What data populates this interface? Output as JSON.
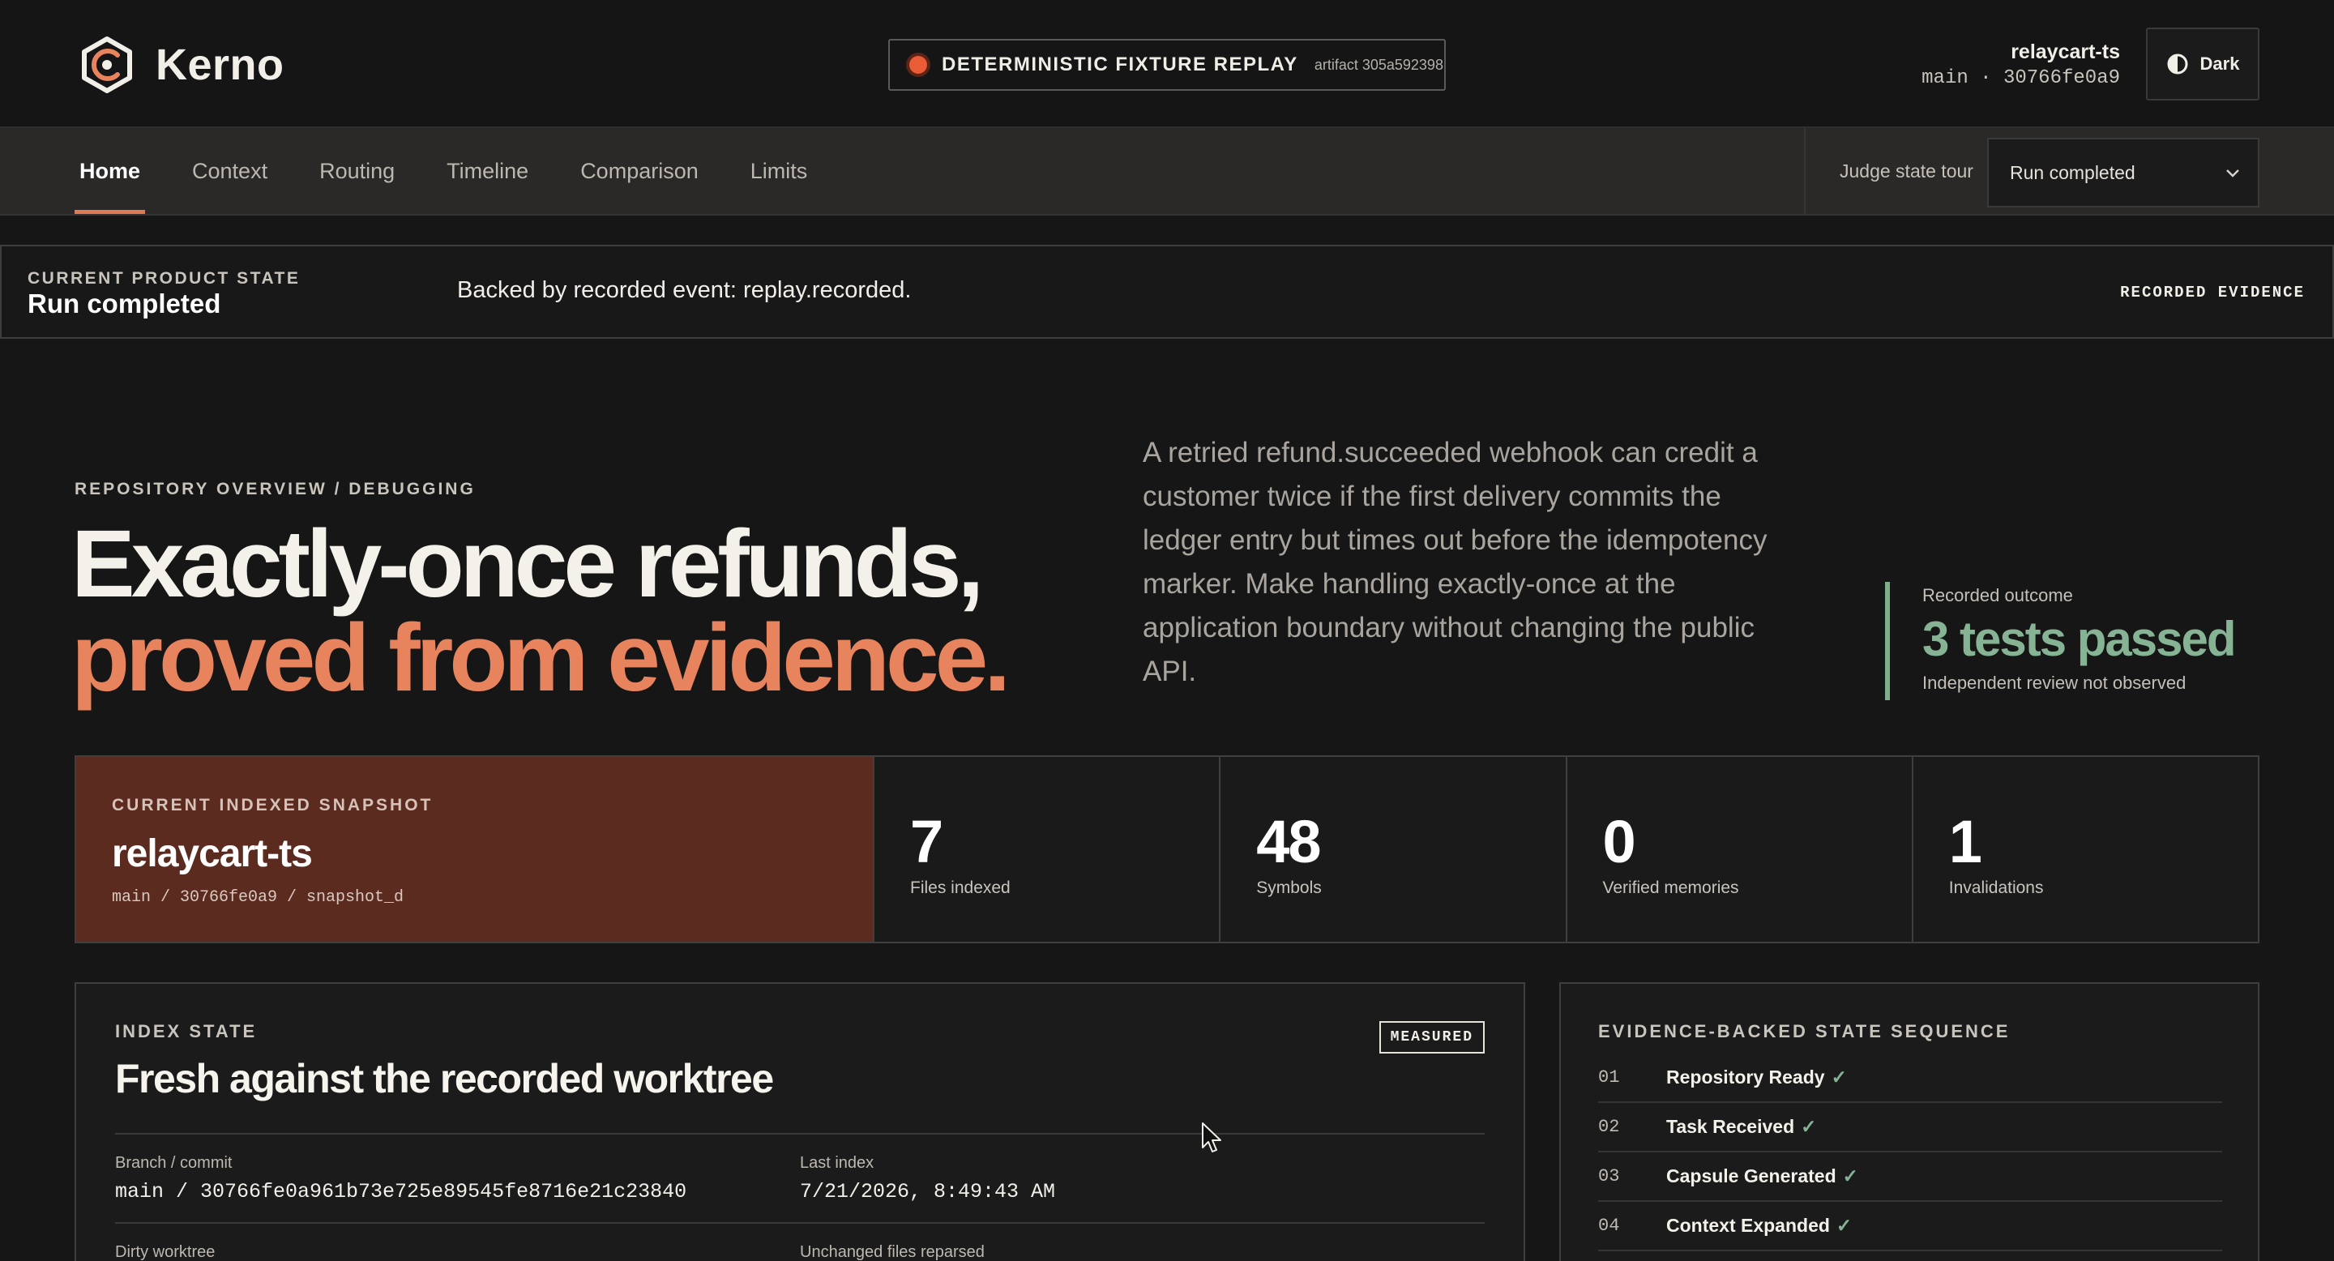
{
  "header": {
    "brand": "Kerno",
    "replay_label": "DETERMINISTIC FIXTURE REPLAY",
    "artifact": "artifact 305a592398",
    "repo_name": "relaycart-ts",
    "repo_commit": "main · 30766fe0a9",
    "theme_label": "Dark"
  },
  "nav": {
    "tabs": [
      {
        "label": "Home",
        "active": true
      },
      {
        "label": "Context",
        "active": false
      },
      {
        "label": "Routing",
        "active": false
      },
      {
        "label": "Timeline",
        "active": false
      },
      {
        "label": "Comparison",
        "active": false
      },
      {
        "label": "Limits",
        "active": false
      }
    ],
    "tour_label": "Judge state tour",
    "tour_selected": "Run completed"
  },
  "state_banner": {
    "caption": "CURRENT PRODUCT STATE",
    "value": "Run completed",
    "event": "Backed by recorded event: replay.recorded.",
    "tag": "RECORDED EVIDENCE"
  },
  "hero": {
    "eyebrow": "REPOSITORY OVERVIEW / DEBUGGING",
    "title_line1": "Exactly-once refunds,",
    "title_line2": "proved from evidence.",
    "description": "A retried refund.succeeded webhook can credit a customer twice if the first delivery commits the ledger entry but times out before the idempotency marker. Make handling exactly-once at the application boundary without changing the public API.",
    "outcome_label": "Recorded outcome",
    "outcome_value": "3 tests passed",
    "outcome_note": "Independent review not observed"
  },
  "snapshot": {
    "caption": "CURRENT INDEXED SNAPSHOT",
    "repo": "relaycart-ts",
    "path": "main / 30766fe0a9 / snapshot_d",
    "stats": [
      {
        "value": "7",
        "label": "Files indexed"
      },
      {
        "value": "48",
        "label": "Symbols"
      },
      {
        "value": "0",
        "label": "Verified memories"
      },
      {
        "value": "1",
        "label": "Invalidations"
      }
    ]
  },
  "index_state": {
    "caption": "INDEX STATE",
    "badge": "MEASURED",
    "title": "Fresh against the recorded worktree",
    "branch_label": "Branch / commit",
    "branch_value": "main / 30766fe0a961b73e725e89545fe8716e21c23840",
    "last_index_label": "Last index",
    "last_index_value": "7/21/2026, 8:49:43 AM",
    "dirty_label": "Dirty worktree",
    "unchanged_label": "Unchanged files reparsed"
  },
  "sequence": {
    "caption": "EVIDENCE-BACKED STATE SEQUENCE",
    "items": [
      {
        "num": "01",
        "name": "Repository Ready",
        "check": "✓"
      },
      {
        "num": "02",
        "name": "Task Received",
        "check": "✓"
      },
      {
        "num": "03",
        "name": "Capsule Generated",
        "check": "✓"
      },
      {
        "num": "04",
        "name": "Context Expanded",
        "check": "✓"
      }
    ]
  },
  "colors": {
    "accent": "#e8845d",
    "success": "#86b394",
    "snapshot_bg": "#5c2b1f",
    "replay_dot": "#ea5c35"
  },
  "icons": {
    "logo": "kerno-logo-icon",
    "theme": "contrast-icon",
    "select": "chevron-down-icon",
    "replay": "record-dot-icon"
  }
}
